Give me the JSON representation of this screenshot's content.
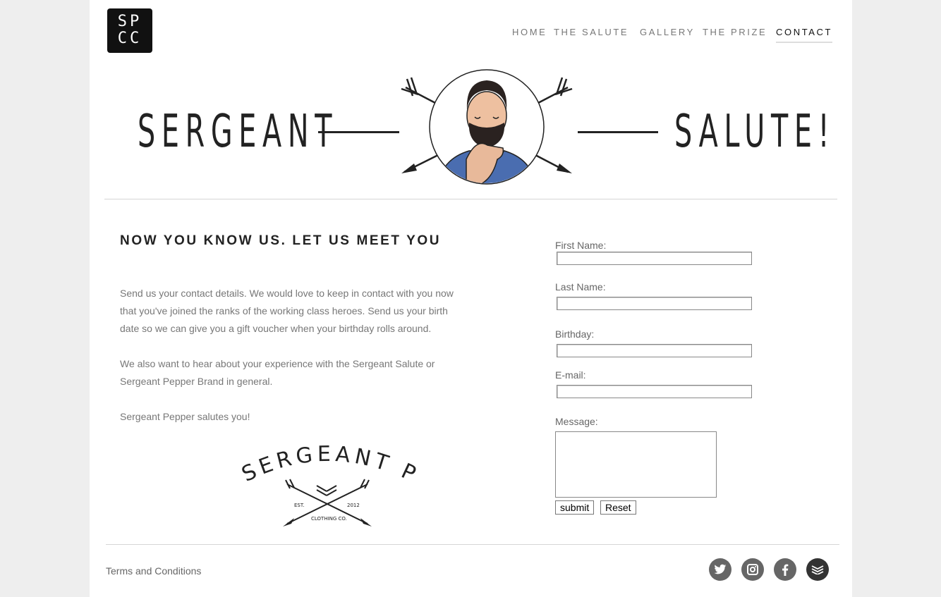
{
  "logo": {
    "line1": "SP",
    "line2": "CC"
  },
  "nav": {
    "home": "HOME",
    "salute": "THE SALUTE",
    "gallery": "GALLERY",
    "prize": "THE PRIZE",
    "contact": "CONTACT"
  },
  "hero": {
    "left_word": "SERGEANT",
    "right_word": "SALUTE!"
  },
  "content": {
    "heading": "NOW YOU KNOW US. LET US MEET YOU",
    "paragraph1": "Send us your contact details. We would love to keep in contact with you now that you've joined the ranks of the working class heroes. Send us your birth date so we can give you a gift voucher when your birthday rolls around.",
    "paragraph2": "We also want to hear about your experience with the Sergeant Salute or Sergeant Pepper Brand in general.",
    "paragraph3": "Sergeant Pepper salutes you!"
  },
  "brand_logo": {
    "name": "SERGEANT PEPPER",
    "est": "EST.",
    "year": "2012",
    "sub": "CLOTHING CO."
  },
  "form": {
    "first_name_label": "First Name:",
    "first_name_value": "",
    "last_name_label": "Last Name:",
    "last_name_value": "",
    "birthday_label": "Birthday:",
    "birthday_value": "",
    "email_label": "E-mail:",
    "email_value": "",
    "message_label": "Message:",
    "message_value": "",
    "submit_label": "submit",
    "reset_label": "Reset"
  },
  "footer": {
    "terms": "Terms and Conditions",
    "social_icons": [
      "twitter-icon",
      "instagram-icon",
      "facebook-icon",
      "layers-icon"
    ]
  }
}
